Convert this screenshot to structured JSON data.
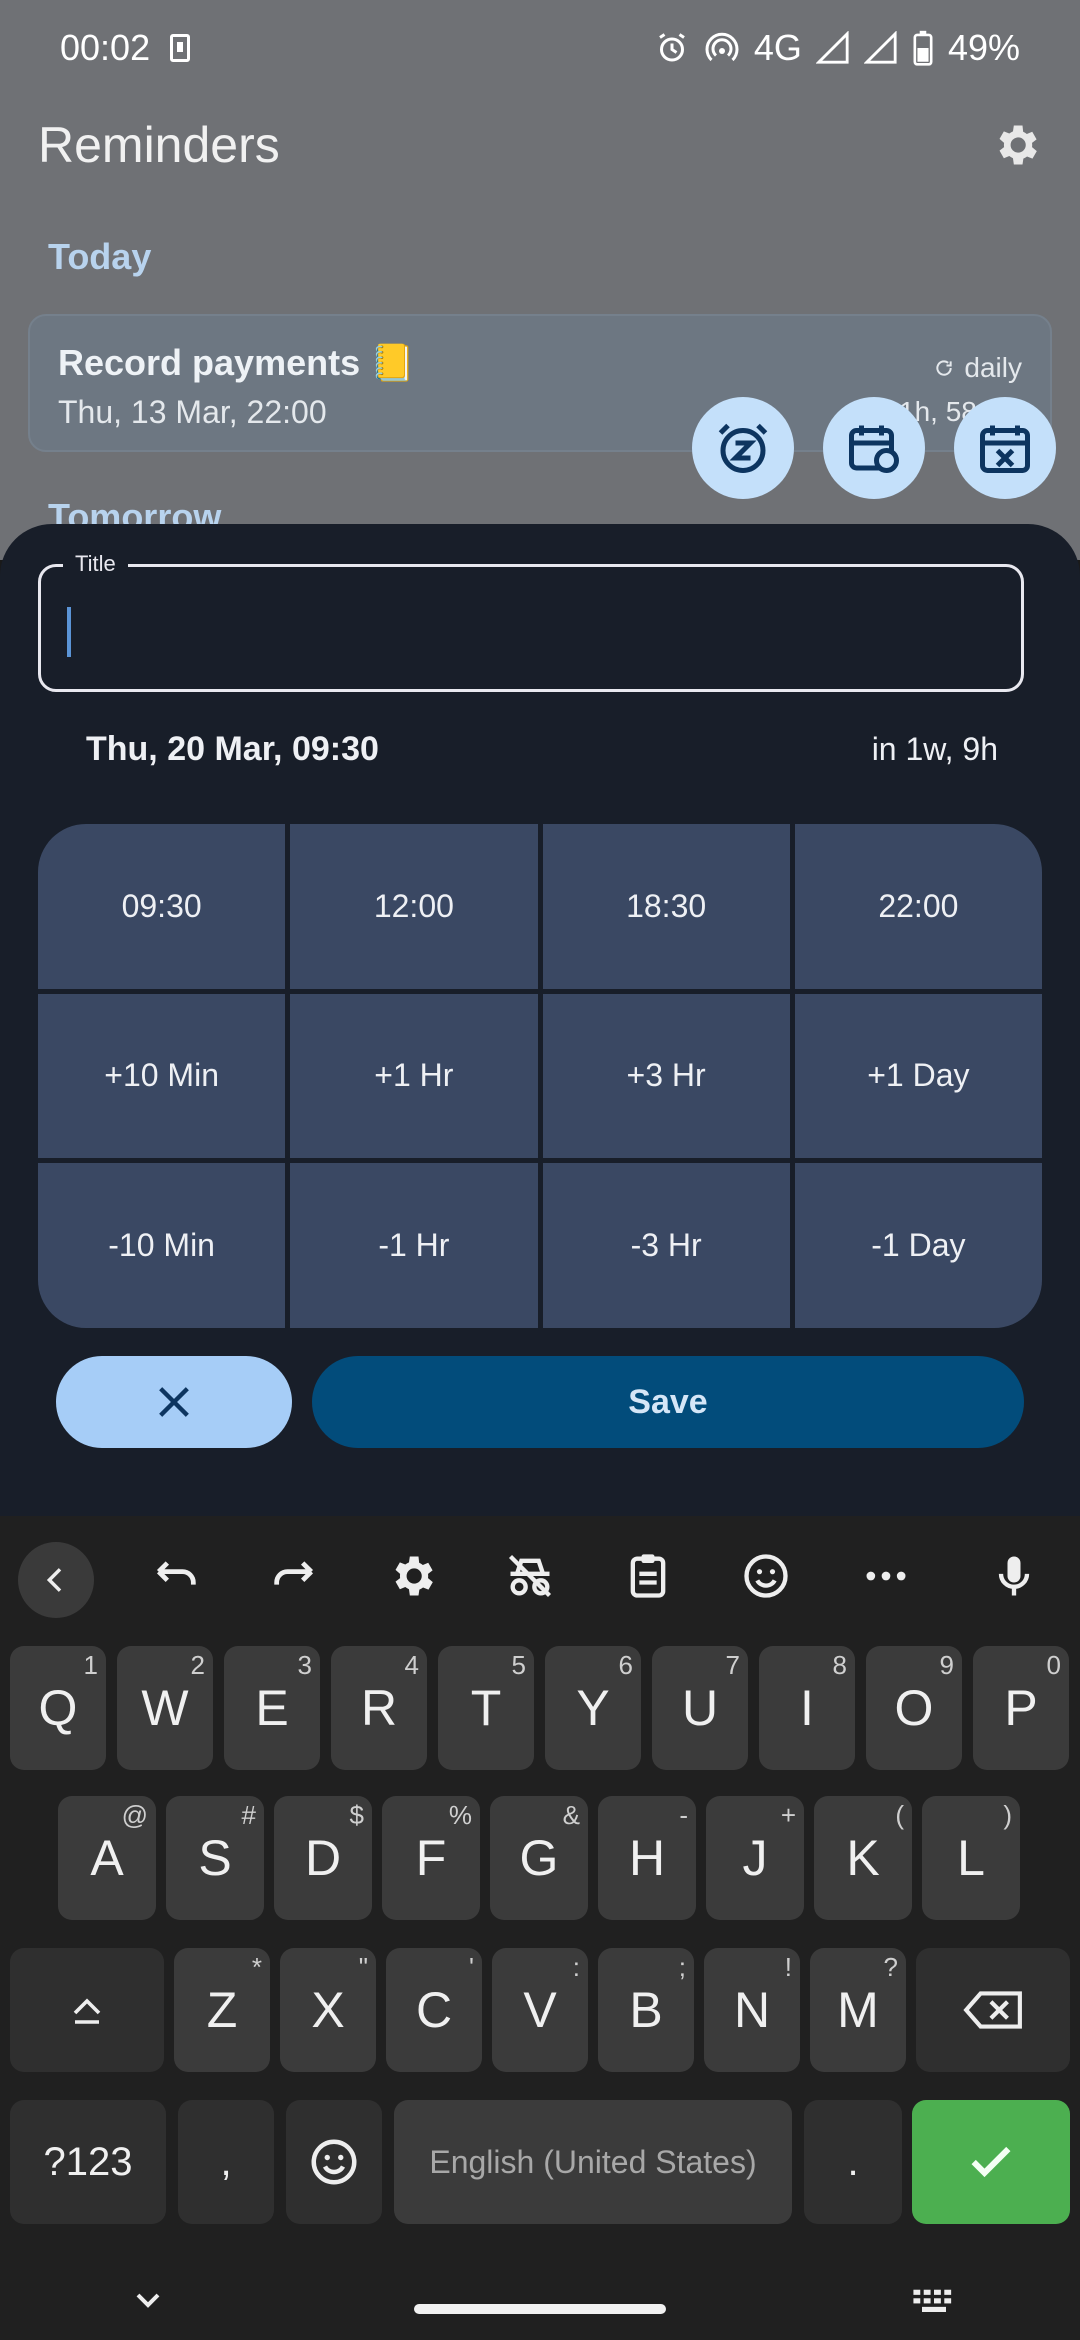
{
  "status_bar": {
    "time": "00:02",
    "network": "4G",
    "battery": "49%"
  },
  "app": {
    "title": "Reminders",
    "settings_icon": "gear-icon",
    "sections": {
      "today": "Today",
      "tomorrow": "Tomorrow"
    },
    "reminder": {
      "title": "Record payments 📒",
      "date": "Thu, 13 Mar, 22:00",
      "repeat": "daily",
      "eta": "in 21h, 58min"
    },
    "fabs": [
      "snooze-icon",
      "reschedule-icon",
      "cancel-date-icon"
    ]
  },
  "sheet": {
    "title_label": "Title",
    "title_value": "",
    "date": "Thu, 20 Mar, 09:30",
    "relative": "in 1w, 9h",
    "grid": [
      [
        "09:30",
        "12:00",
        "18:30",
        "22:00"
      ],
      [
        "+10 Min",
        "+1 Hr",
        "+3 Hr",
        "+1 Day"
      ],
      [
        "-10 Min",
        "-1 Hr",
        "-3 Hr",
        "-1 Day"
      ]
    ],
    "cancel_icon": "close-icon",
    "save_label": "Save"
  },
  "keyboard": {
    "toolbar": [
      "back-icon",
      "undo-icon",
      "redo-icon",
      "settings-icon",
      "incognito-icon",
      "clipboard-icon",
      "emoji-icon",
      "more-icon",
      "mic-icon"
    ],
    "row1": [
      {
        "k": "Q",
        "h": "1"
      },
      {
        "k": "W",
        "h": "2"
      },
      {
        "k": "E",
        "h": "3"
      },
      {
        "k": "R",
        "h": "4"
      },
      {
        "k": "T",
        "h": "5"
      },
      {
        "k": "Y",
        "h": "6"
      },
      {
        "k": "U",
        "h": "7"
      },
      {
        "k": "I",
        "h": "8"
      },
      {
        "k": "O",
        "h": "9"
      },
      {
        "k": "P",
        "h": "0"
      }
    ],
    "row2": [
      {
        "k": "A",
        "h": "@"
      },
      {
        "k": "S",
        "h": "#"
      },
      {
        "k": "D",
        "h": "$"
      },
      {
        "k": "F",
        "h": "%"
      },
      {
        "k": "G",
        "h": "&"
      },
      {
        "k": "H",
        "h": "-"
      },
      {
        "k": "J",
        "h": "+"
      },
      {
        "k": "K",
        "h": "("
      },
      {
        "k": "L",
        "h": ")"
      }
    ],
    "row3": [
      {
        "k": "Z",
        "h": "*"
      },
      {
        "k": "X",
        "h": "\""
      },
      {
        "k": "C",
        "h": "'"
      },
      {
        "k": "V",
        "h": ":"
      },
      {
        "k": "B",
        "h": ";"
      },
      {
        "k": "N",
        "h": "!"
      },
      {
        "k": "M",
        "h": "?"
      }
    ],
    "symbols_label": "?123",
    "comma": ",",
    "period": ".",
    "space_label": "English (United States)"
  }
}
